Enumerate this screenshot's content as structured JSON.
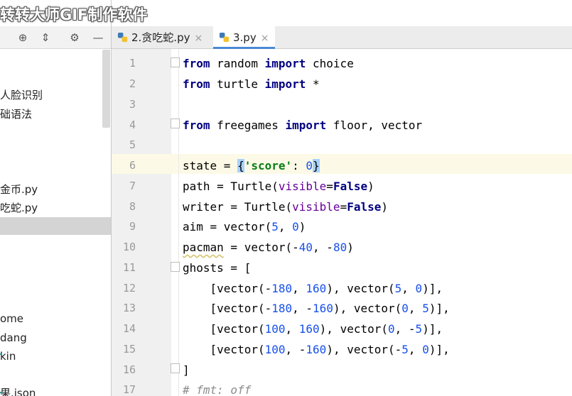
{
  "watermark": "转转大师GIF制作软件",
  "left_panel": {
    "tree_items": [
      "人脸识别",
      "基础语法",
      "金币.py",
      "贪吃蛇.py",
      "ome",
      "dang",
      "kin",
      "果.json"
    ],
    "tree_items_visible": [
      "人脸识别",
      "础语法",
      "金币.py",
      "吃蛇.py",
      "ome",
      "dang",
      "kin",
      "果.json"
    ]
  },
  "tabs": [
    {
      "label": "2.贪吃蛇.py",
      "close": "×",
      "active": false
    },
    {
      "label": "3.py",
      "close": "×",
      "active": true
    }
  ],
  "editor": {
    "current_line": 6,
    "line_numbers": [
      "1",
      "2",
      "3",
      "4",
      "5",
      "6",
      "7",
      "8",
      "9",
      "10",
      "11",
      "12",
      "13",
      "14",
      "15",
      "16",
      "17"
    ]
  },
  "colors": {
    "keyword": "#000080",
    "number": "#1750eb",
    "string": "#067d17",
    "param": "#660099",
    "comment": "#8c8c8c",
    "current_line_bg": "#fcfae6",
    "active_tab_underline": "#4a88d6"
  }
}
